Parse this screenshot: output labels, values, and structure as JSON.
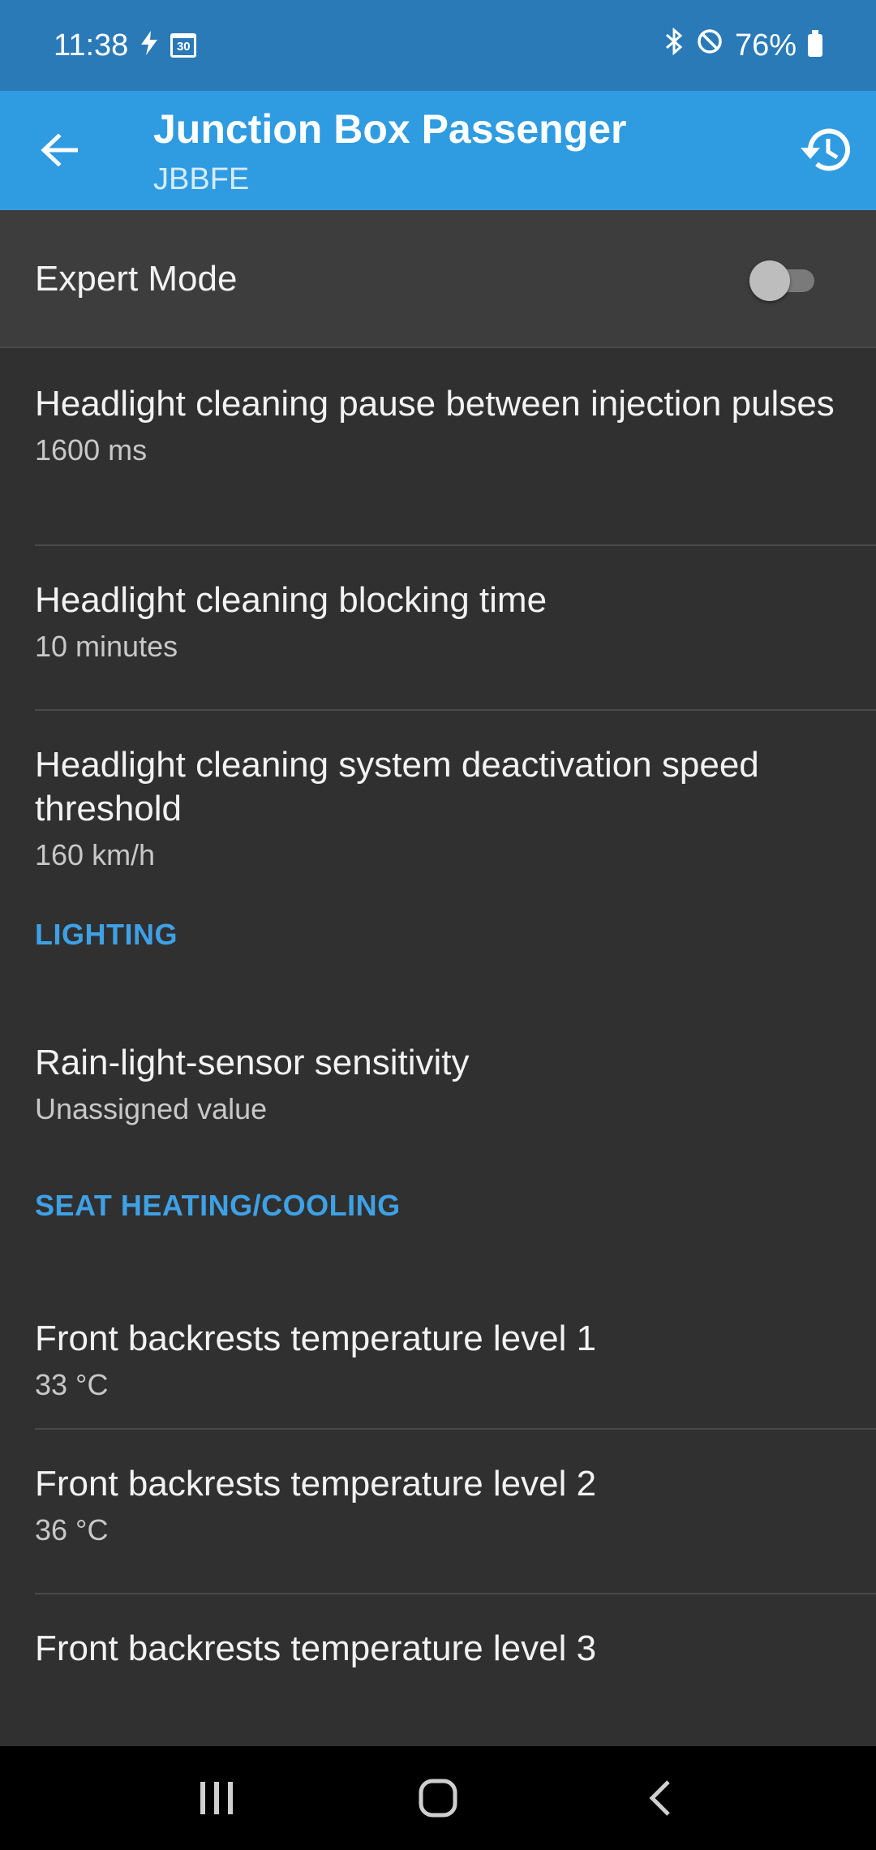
{
  "status_bar": {
    "time": "11:38",
    "flash_icon": "flash-icon",
    "calendar_day": "30",
    "bluetooth_icon": "bluetooth-icon",
    "dnd_icon": "do-not-disturb-icon",
    "battery_percent": "76%"
  },
  "app_bar": {
    "title": "Junction Box Passenger",
    "subtitle": "JBBFE",
    "back_icon": "arrow-back-icon",
    "history_icon": "history-icon",
    "background_color": "#2f9be0"
  },
  "expert_mode": {
    "label": "Expert Mode",
    "enabled": false
  },
  "items": [
    {
      "title": "Headlight cleaning pause between injection pulses",
      "value": "1600 ms"
    },
    {
      "title": "Headlight cleaning blocking time",
      "value": "10 minutes"
    },
    {
      "title": "Headlight cleaning system deactivation speed threshold",
      "value": "160 km/h"
    }
  ],
  "sections": {
    "lighting": {
      "header": "LIGHTING",
      "items": [
        {
          "title": "Rain-light-sensor sensitivity",
          "value": "Unassigned value"
        }
      ]
    },
    "seat": {
      "header": "SEAT HEATING/COOLING",
      "items": [
        {
          "title": "Front backrests temperature level 1",
          "value": "33 °C"
        },
        {
          "title": "Front backrests temperature level 2",
          "value": "36 °C"
        },
        {
          "title": "Front backrests temperature level 3",
          "value": ""
        }
      ]
    }
  },
  "colors": {
    "accent": "#3ea1e6",
    "status_bar": "#2a7ab8",
    "background": "#303030"
  }
}
